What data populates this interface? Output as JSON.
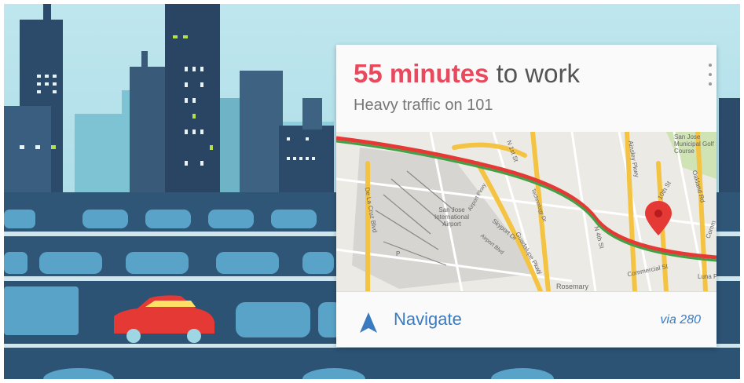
{
  "card": {
    "title_highlight": "55 minutes",
    "title_rest": " to work",
    "subtitle": "Heavy traffic on 101",
    "menu_icon": "overflow-menu-icon",
    "navigate_label": "Navigate",
    "navigate_icon": "navigation-arrow-icon",
    "via": "via 280"
  },
  "map": {
    "labels": {
      "airport": "San Jose International Airport",
      "golf": "San Jose Municipal Golf Course",
      "rosemary": "Rosemary",
      "luna": "Luna P",
      "commercial": "Commercial St",
      "skyport": "Skyport Dr",
      "n1st": "N 1st St",
      "n4th": "N 4th St",
      "guadalupe": "Guadalupe Pkwy",
      "coleman": "De La Cruz Blvd",
      "oakland": "Oakland Rd",
      "tenth": "10th St",
      "pkwy": "Ainsley Pkwy",
      "airport_pkwy": "Airport Pkwy",
      "technology": "Technology Dr",
      "airport_blvd": "Airport Blvd",
      "p": "P",
      "comm": "Comm"
    },
    "colors": {
      "traffic_heavy": "#e53935",
      "traffic_clear": "#43a047",
      "pin": "#e53935"
    }
  },
  "colors": {
    "accent": "#e9495c",
    "link": "#3a7bbf",
    "car": "#e53935"
  }
}
